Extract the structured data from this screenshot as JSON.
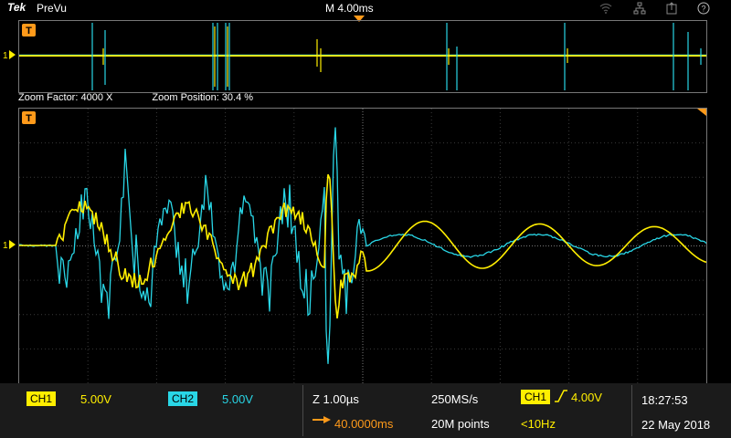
{
  "topbar": {
    "brand": "Tek",
    "mode": "PreVu",
    "timebase": "M 4.00ms",
    "icons": [
      "wifi-icon",
      "network-icon",
      "export-icon",
      "help-icon"
    ]
  },
  "zoom": {
    "factor": "Zoom Factor: 4000 X",
    "position": "Zoom Position: 30.4 %"
  },
  "markers": {
    "trigger": "T",
    "ground": "1"
  },
  "bottom": {
    "ch1": {
      "label": "CH1",
      "scale": "5.00V",
      "color": "#ffee00"
    },
    "ch2": {
      "label": "CH2",
      "scale": "5.00V",
      "color": "#29d6e6"
    },
    "horizontal": {
      "zoom_scale": "Z 1.00µs",
      "position": "40.0000ms",
      "sample_rate": "250MS/s",
      "record_length": "20M points"
    },
    "trigger": {
      "source": "CH1",
      "level": "4.00V",
      "frequency": "<10Hz"
    },
    "datetime": {
      "time": "18:27:53",
      "date": "22 May 2018"
    }
  }
}
